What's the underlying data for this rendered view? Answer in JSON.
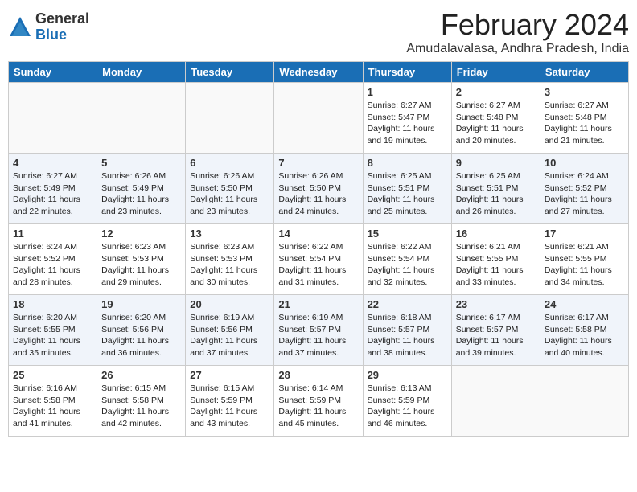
{
  "logo": {
    "general": "General",
    "blue": "Blue"
  },
  "title": "February 2024",
  "location": "Amudalavalasa, Andhra Pradesh, India",
  "days_of_week": [
    "Sunday",
    "Monday",
    "Tuesday",
    "Wednesday",
    "Thursday",
    "Friday",
    "Saturday"
  ],
  "weeks": [
    [
      {
        "day": "",
        "info": ""
      },
      {
        "day": "",
        "info": ""
      },
      {
        "day": "",
        "info": ""
      },
      {
        "day": "",
        "info": ""
      },
      {
        "day": "1",
        "info": "Sunrise: 6:27 AM\nSunset: 5:47 PM\nDaylight: 11 hours and 19 minutes."
      },
      {
        "day": "2",
        "info": "Sunrise: 6:27 AM\nSunset: 5:48 PM\nDaylight: 11 hours and 20 minutes."
      },
      {
        "day": "3",
        "info": "Sunrise: 6:27 AM\nSunset: 5:48 PM\nDaylight: 11 hours and 21 minutes."
      }
    ],
    [
      {
        "day": "4",
        "info": "Sunrise: 6:27 AM\nSunset: 5:49 PM\nDaylight: 11 hours and 22 minutes."
      },
      {
        "day": "5",
        "info": "Sunrise: 6:26 AM\nSunset: 5:49 PM\nDaylight: 11 hours and 23 minutes."
      },
      {
        "day": "6",
        "info": "Sunrise: 6:26 AM\nSunset: 5:50 PM\nDaylight: 11 hours and 23 minutes."
      },
      {
        "day": "7",
        "info": "Sunrise: 6:26 AM\nSunset: 5:50 PM\nDaylight: 11 hours and 24 minutes."
      },
      {
        "day": "8",
        "info": "Sunrise: 6:25 AM\nSunset: 5:51 PM\nDaylight: 11 hours and 25 minutes."
      },
      {
        "day": "9",
        "info": "Sunrise: 6:25 AM\nSunset: 5:51 PM\nDaylight: 11 hours and 26 minutes."
      },
      {
        "day": "10",
        "info": "Sunrise: 6:24 AM\nSunset: 5:52 PM\nDaylight: 11 hours and 27 minutes."
      }
    ],
    [
      {
        "day": "11",
        "info": "Sunrise: 6:24 AM\nSunset: 5:52 PM\nDaylight: 11 hours and 28 minutes."
      },
      {
        "day": "12",
        "info": "Sunrise: 6:23 AM\nSunset: 5:53 PM\nDaylight: 11 hours and 29 minutes."
      },
      {
        "day": "13",
        "info": "Sunrise: 6:23 AM\nSunset: 5:53 PM\nDaylight: 11 hours and 30 minutes."
      },
      {
        "day": "14",
        "info": "Sunrise: 6:22 AM\nSunset: 5:54 PM\nDaylight: 11 hours and 31 minutes."
      },
      {
        "day": "15",
        "info": "Sunrise: 6:22 AM\nSunset: 5:54 PM\nDaylight: 11 hours and 32 minutes."
      },
      {
        "day": "16",
        "info": "Sunrise: 6:21 AM\nSunset: 5:55 PM\nDaylight: 11 hours and 33 minutes."
      },
      {
        "day": "17",
        "info": "Sunrise: 6:21 AM\nSunset: 5:55 PM\nDaylight: 11 hours and 34 minutes."
      }
    ],
    [
      {
        "day": "18",
        "info": "Sunrise: 6:20 AM\nSunset: 5:55 PM\nDaylight: 11 hours and 35 minutes."
      },
      {
        "day": "19",
        "info": "Sunrise: 6:20 AM\nSunset: 5:56 PM\nDaylight: 11 hours and 36 minutes."
      },
      {
        "day": "20",
        "info": "Sunrise: 6:19 AM\nSunset: 5:56 PM\nDaylight: 11 hours and 37 minutes."
      },
      {
        "day": "21",
        "info": "Sunrise: 6:19 AM\nSunset: 5:57 PM\nDaylight: 11 hours and 37 minutes."
      },
      {
        "day": "22",
        "info": "Sunrise: 6:18 AM\nSunset: 5:57 PM\nDaylight: 11 hours and 38 minutes."
      },
      {
        "day": "23",
        "info": "Sunrise: 6:17 AM\nSunset: 5:57 PM\nDaylight: 11 hours and 39 minutes."
      },
      {
        "day": "24",
        "info": "Sunrise: 6:17 AM\nSunset: 5:58 PM\nDaylight: 11 hours and 40 minutes."
      }
    ],
    [
      {
        "day": "25",
        "info": "Sunrise: 6:16 AM\nSunset: 5:58 PM\nDaylight: 11 hours and 41 minutes."
      },
      {
        "day": "26",
        "info": "Sunrise: 6:15 AM\nSunset: 5:58 PM\nDaylight: 11 hours and 42 minutes."
      },
      {
        "day": "27",
        "info": "Sunrise: 6:15 AM\nSunset: 5:59 PM\nDaylight: 11 hours and 43 minutes."
      },
      {
        "day": "28",
        "info": "Sunrise: 6:14 AM\nSunset: 5:59 PM\nDaylight: 11 hours and 45 minutes."
      },
      {
        "day": "29",
        "info": "Sunrise: 6:13 AM\nSunset: 5:59 PM\nDaylight: 11 hours and 46 minutes."
      },
      {
        "day": "",
        "info": ""
      },
      {
        "day": "",
        "info": ""
      }
    ]
  ]
}
